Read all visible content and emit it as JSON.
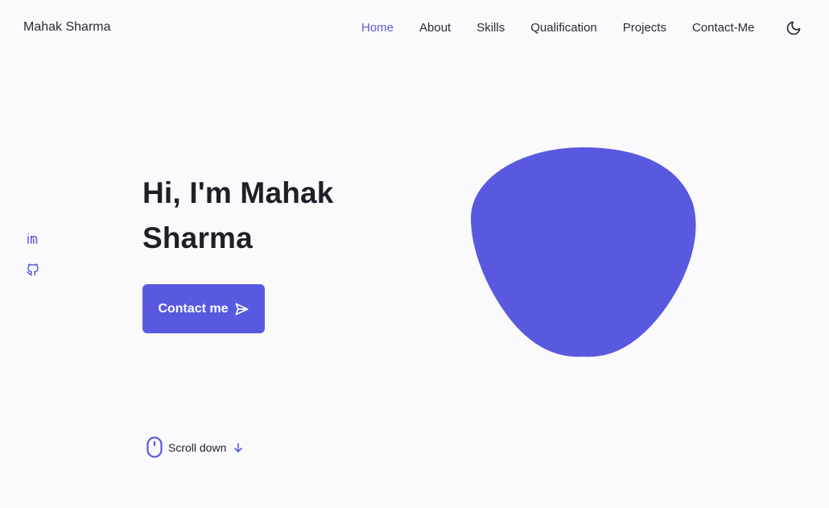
{
  "header": {
    "logo": "Mahak Sharma",
    "nav": [
      {
        "label": "Home",
        "active": true
      },
      {
        "label": "About",
        "active": false
      },
      {
        "label": "Skills",
        "active": false
      },
      {
        "label": "Qualification",
        "active": false
      },
      {
        "label": "Projects",
        "active": false
      },
      {
        "label": "Contact-Me",
        "active": false
      }
    ],
    "theme_icon": "moon-icon"
  },
  "social": [
    {
      "icon": "linkedin-icon"
    },
    {
      "icon": "github-icon"
    }
  ],
  "hero": {
    "title_line1": "Hi, I'm Mahak",
    "title_line2": "Sharma",
    "button_label": "Contact me",
    "button_icon": "send-icon"
  },
  "scroll": {
    "label": "Scroll down",
    "icon": "mouse-icon",
    "arrow_icon": "arrow-down-icon"
  },
  "colors": {
    "accent": "#5959e0",
    "background": "#fafafc",
    "text": "#1f1f2a"
  }
}
